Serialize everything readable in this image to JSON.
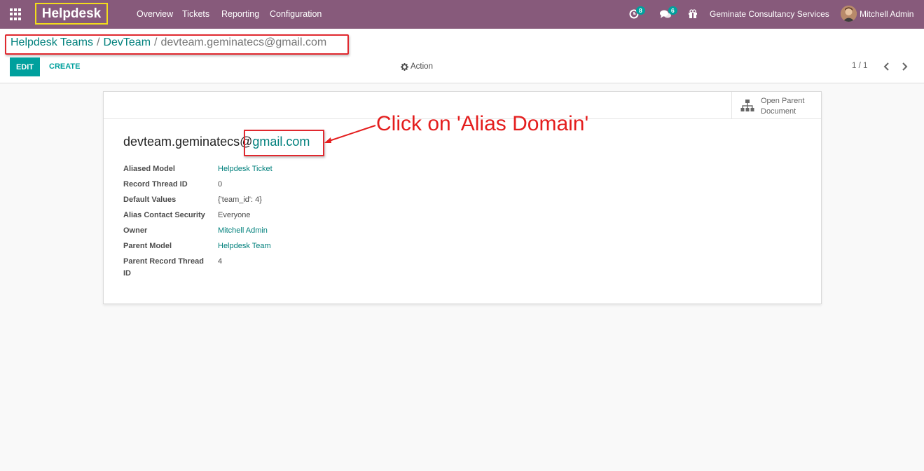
{
  "navbar": {
    "app_name": "Helpdesk",
    "menu": [
      "Overview",
      "Tickets",
      "Reporting",
      "Configuration"
    ],
    "activity_count": "8",
    "messages_count": "6",
    "company": "Geminate Consultancy Services",
    "user": "Mitchell Admin",
    "background_color": "#875a7b"
  },
  "breadcrumb": {
    "items": [
      "Helpdesk Teams",
      "DevTeam"
    ],
    "separator": "/",
    "current": "devteam.geminatecs@gmail.com"
  },
  "toolbar": {
    "edit_label": "EDIT",
    "create_label": "CREATE",
    "action_label": "Action",
    "pager": "1 / 1",
    "accent_color": "#00a09d"
  },
  "record": {
    "smart_button": [
      "Open Parent",
      "Document"
    ],
    "alias_name": "devteam.geminatecs@",
    "alias_domain": "gmail.com",
    "fields": [
      {
        "label": "Aliased Model",
        "value": "Helpdesk Ticket",
        "link": true
      },
      {
        "label": "Record Thread ID",
        "value": "0",
        "link": false
      },
      {
        "label": "Default Values",
        "value": "{'team_id': 4}",
        "link": false
      },
      {
        "label": "Alias Contact Security",
        "value": "Everyone",
        "link": false
      },
      {
        "label": "Owner",
        "value": "Mitchell Admin",
        "link": true
      },
      {
        "label": "Parent Model",
        "value": "Helpdesk Team",
        "link": true
      },
      {
        "label": "Parent Record Thread",
        "label_line2": "ID",
        "value": "4",
        "link": false
      }
    ]
  },
  "annotation": {
    "text": "Click on 'Alias Domain'",
    "color": "#e41d1d"
  }
}
